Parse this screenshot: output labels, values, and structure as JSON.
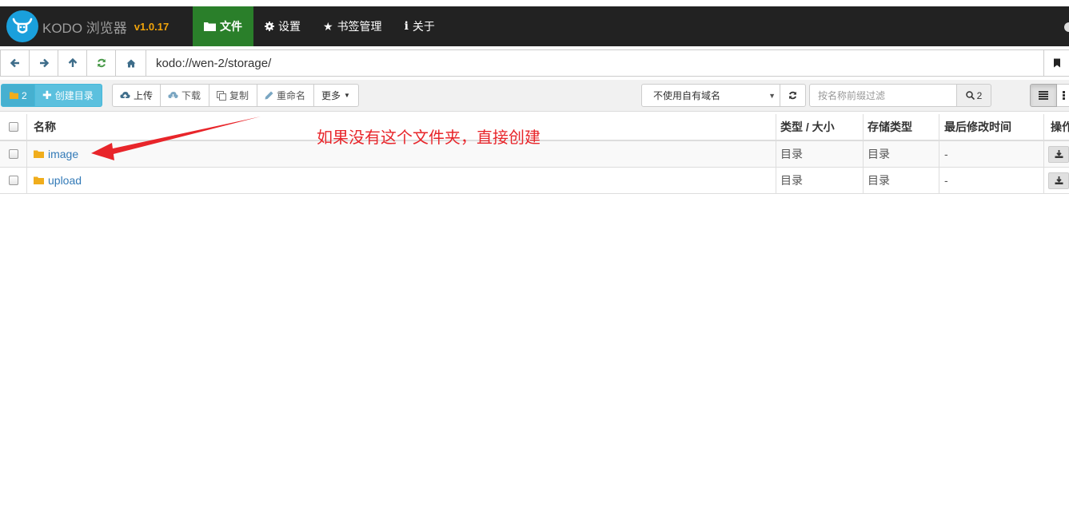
{
  "navbar": {
    "brand_name": "KODO 浏览器",
    "version": "v1.0.17",
    "items": [
      {
        "label": "文件",
        "icon": "folder-icon",
        "active": true
      },
      {
        "label": "设置",
        "icon": "gear-icon",
        "active": false
      },
      {
        "label": "书签管理",
        "icon": "star-icon",
        "active": false
      },
      {
        "label": "关于",
        "icon": "info-icon",
        "active": false
      }
    ]
  },
  "address_bar": {
    "path": "kodo://wen-2/storage/"
  },
  "toolbar": {
    "folder_count": "2",
    "create_dir_label": "创建目录",
    "upload_label": "上传",
    "download_label": "下载",
    "copy_label": "复制",
    "rename_label": "重命名",
    "more_label": "更多",
    "domain_select": "不使用自有域名",
    "search_placeholder": "按名称前缀过滤",
    "search_count": "2"
  },
  "table": {
    "headers": {
      "name": "名称",
      "type_size": "类型 / 大小",
      "storage_type": "存储类型",
      "modified": "最后修改时间",
      "actions": "操作"
    },
    "rows": [
      {
        "name": "image",
        "type": "目录",
        "storage": "目录",
        "modified": "-"
      },
      {
        "name": "upload",
        "type": "目录",
        "storage": "目录",
        "modified": "-"
      }
    ]
  },
  "annotation": {
    "text": "如果没有这个文件夹，直接创建",
    "color": "#e8252a"
  },
  "colors": {
    "navbar_bg": "#222222",
    "active_tab": "#2a7f2a",
    "version": "#f0a30a",
    "folder": "#f0ad1c",
    "link": "#337ab7",
    "info_button": "#5bc0de"
  }
}
